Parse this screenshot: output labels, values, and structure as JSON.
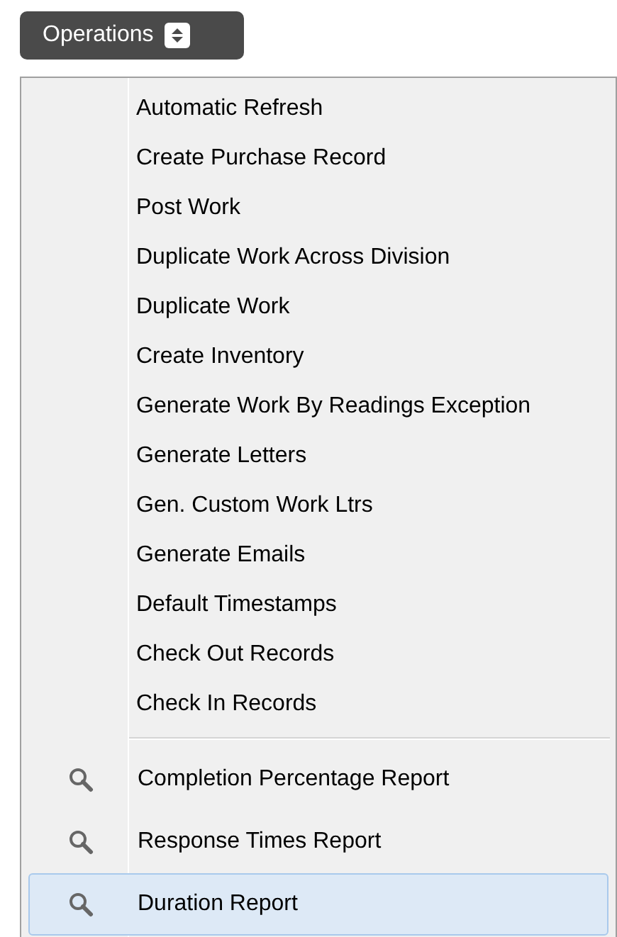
{
  "operations_button": {
    "label": "Operations"
  },
  "menu": {
    "items": [
      {
        "label": "Automatic Refresh",
        "kind": "plain",
        "selected": false
      },
      {
        "label": "Create Purchase Record",
        "kind": "plain",
        "selected": false
      },
      {
        "label": "Post Work",
        "kind": "plain",
        "selected": false
      },
      {
        "label": "Duplicate Work Across Division",
        "kind": "plain",
        "selected": false
      },
      {
        "label": "Duplicate Work",
        "kind": "plain",
        "selected": false
      },
      {
        "label": "Create Inventory",
        "kind": "plain",
        "selected": false
      },
      {
        "label": "Generate Work By Readings Exception",
        "kind": "plain",
        "selected": false
      },
      {
        "label": "Generate Letters",
        "kind": "plain",
        "selected": false
      },
      {
        "label": "Gen. Custom Work Ltrs",
        "kind": "plain",
        "selected": false
      },
      {
        "label": "Generate Emails",
        "kind": "plain",
        "selected": false
      },
      {
        "label": "Default Timestamps",
        "kind": "plain",
        "selected": false
      },
      {
        "label": "Check Out Records",
        "kind": "plain",
        "selected": false
      },
      {
        "label": "Check In Records",
        "kind": "plain",
        "selected": false
      },
      {
        "kind": "separator"
      },
      {
        "label": "Completion Percentage Report",
        "kind": "report",
        "selected": false
      },
      {
        "label": "Response Times Report",
        "kind": "report",
        "selected": false
      },
      {
        "label": "Duration Report",
        "kind": "report",
        "selected": true
      }
    ]
  }
}
